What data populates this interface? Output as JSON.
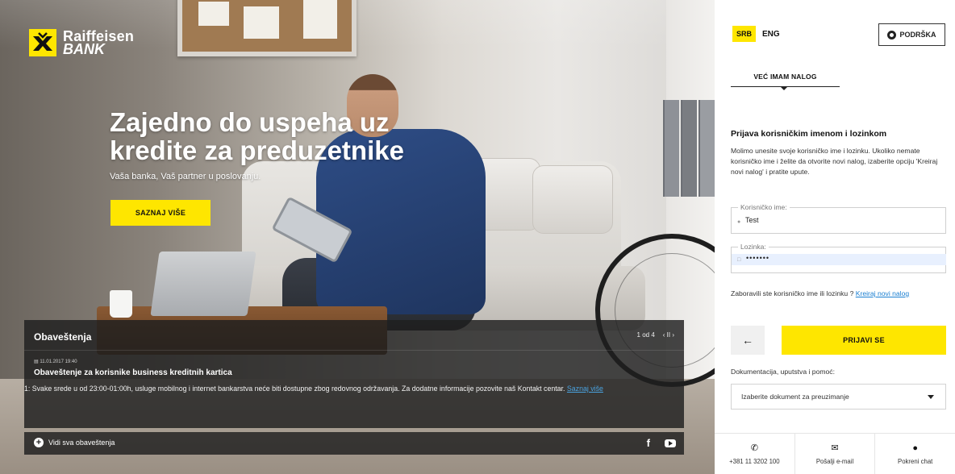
{
  "brand": {
    "line1": "Raiffeisen",
    "line2": "BANK",
    "accent_color": "#fee600"
  },
  "hero": {
    "headline": "Zajedno do uspeha uz kredite za preduzetnike",
    "subline": "Vaša banka, Vaš partner u poslovanju.",
    "cta_label": "SAZNAJ VIŠE"
  },
  "notifications": {
    "title": "Obaveštenja",
    "pager": "1 od 4",
    "pager_controls": "‹ II ›",
    "date": "11.01.2017 19:40",
    "subject": "Obaveštenje za korisnike business kreditnih kartica",
    "body": "1: Svake srede u od 23:00-01:00h, usluge mobilnog i internet bankarstva neće biti dostupne zbog redovnog održavanja. Za dodatne informacije pozovite naš Kontakt centar.",
    "body_link": "Saznaj više",
    "see_all": "Vidi sva obaveštenja",
    "social": [
      "facebook-icon",
      "youtube-icon"
    ]
  },
  "panel": {
    "lang_active": "SRB",
    "lang_other": "ENG",
    "support_label": "PODRŠKA",
    "tab_label": "VEĆ IMAM NALOG",
    "login_title": "Prijava korisničkim imenom i lozinkom",
    "login_desc": "Molimo unesite svoje korisničko ime i lozinku. Ukoliko nemate korisničko ime i želite da otvorite novi nalog, izaberite opciju 'Kreiraj novi nalog' i pratite upute.",
    "username_label": "Korisničko ime:",
    "username_value": "Test",
    "password_label": "Lozinka:",
    "password_value": "•••••••",
    "forgot_text": "Zaboravili ste korisničko ime ili lozinku ?",
    "forgot_link": "Kreiraj novi nalog",
    "back_label": "←",
    "login_button": "PRIJAVI SE",
    "doc_label": "Dokumentacija, uputstva i pomoć:",
    "doc_select": "Izaberite dokument za preuzimanje",
    "contacts": [
      {
        "icon": "phone-icon",
        "label": "+381 11 3202 100"
      },
      {
        "icon": "mail-icon",
        "label": "Pošalji e-mail"
      },
      {
        "icon": "chat-icon",
        "label": "Pokreni chat"
      }
    ]
  }
}
